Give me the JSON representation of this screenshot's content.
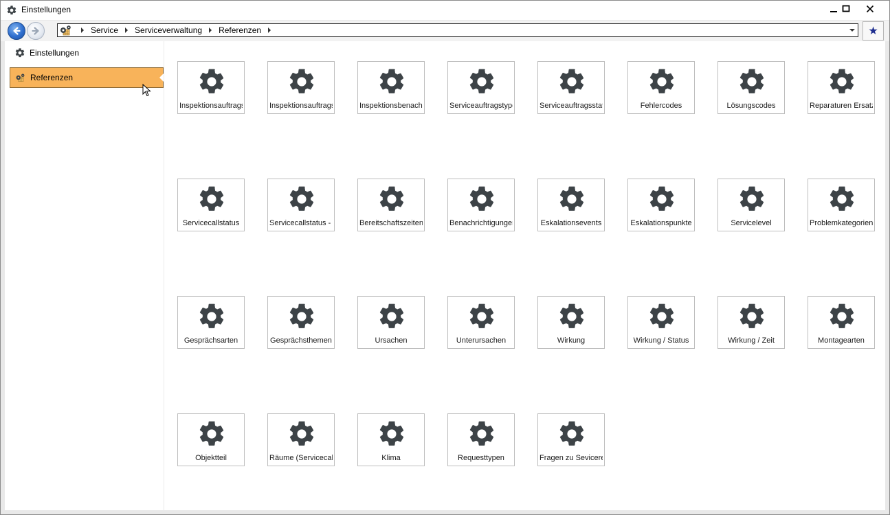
{
  "window": {
    "title": "Einstellungen",
    "icon": "gear-icon",
    "controls": [
      "minimize-icon",
      "maximize-icon",
      "close-icon"
    ]
  },
  "nav": {
    "back_icon": "back-arrow-icon",
    "forward_icon": "forward-arrow-icon",
    "breadcrumbs": [
      "Service",
      "Serviceverwaltung",
      "Referenzen"
    ],
    "favorite_icon": "star-icon"
  },
  "sidebar": {
    "items": [
      {
        "label": "Einstellungen",
        "icon": "gear-icon",
        "selected": false
      },
      {
        "label": "Referenzen",
        "icon": "references-gear-icon",
        "selected": true
      }
    ]
  },
  "tiles": [
    {
      "label": "Inspektionsauftrags"
    },
    {
      "label": "Inspektionsauftrags"
    },
    {
      "label": "Inspektionsbenachr"
    },
    {
      "label": "Serviceauftragstype"
    },
    {
      "label": "Serviceauftragsstatu"
    },
    {
      "label": "Fehlercodes"
    },
    {
      "label": "Lösungscodes"
    },
    {
      "label": "Reparaturen Ersatz"
    },
    {
      "label": "Servicecallstatus"
    },
    {
      "label": "Servicecallstatus - Ä"
    },
    {
      "label": "Bereitschaftszeiten"
    },
    {
      "label": "Benachrichtigunger"
    },
    {
      "label": "Eskalationsevents"
    },
    {
      "label": "Eskalationspunkte"
    },
    {
      "label": "Servicelevel"
    },
    {
      "label": "Problemkategorien"
    },
    {
      "label": "Gesprächsarten"
    },
    {
      "label": "Gesprächsthemen"
    },
    {
      "label": "Ursachen"
    },
    {
      "label": "Unterursachen"
    },
    {
      "label": "Wirkung"
    },
    {
      "label": "Wirkung / Status"
    },
    {
      "label": "Wirkung / Zeit"
    },
    {
      "label": "Montagearten"
    },
    {
      "label": "Objektteil"
    },
    {
      "label": "Räume (Servicecall)"
    },
    {
      "label": "Klima"
    },
    {
      "label": "Requesttypen"
    },
    {
      "label": "Fragen zu Sevicerec"
    }
  ],
  "colors": {
    "selected_bg": "#f8b35a",
    "gear": "#3d4347",
    "favorite_star": "#1e2e8f"
  }
}
